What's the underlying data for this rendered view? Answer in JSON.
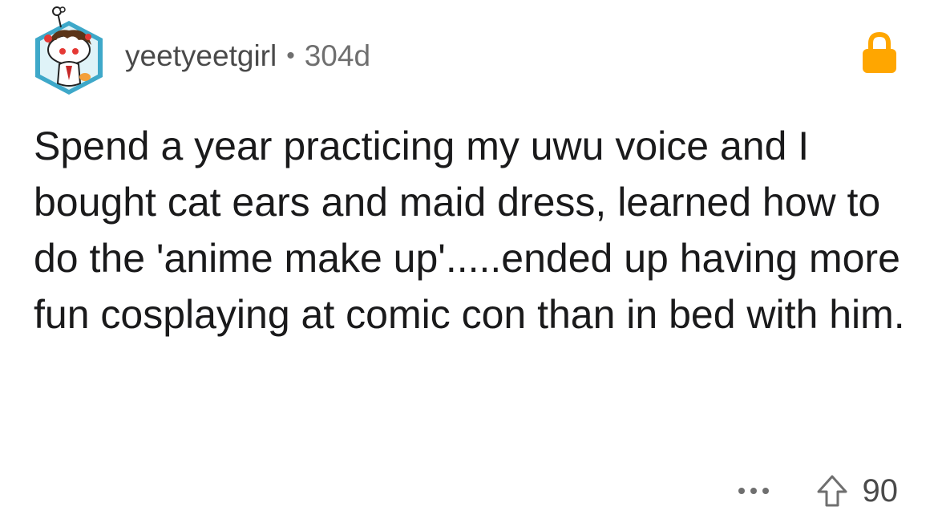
{
  "comment": {
    "username": "yeetyeetgirl",
    "separator": "•",
    "age": "304d",
    "body": "Spend a year practicing my uwu voice and I bought cat ears and maid dress, learned how to do the 'anime make up'.....ended up having more fun cosplaying at comic con than in bed with him.",
    "score": "90"
  },
  "icons": {
    "avatar": "snoo-avatar",
    "lock": "lock-icon",
    "more": "more-options-icon",
    "upvote": "upvote-arrow-icon"
  },
  "colors": {
    "lock": "#ffa600",
    "avatar_border": "#3ea8c9",
    "text": "#1a1a1b",
    "muted": "#6f6f6f"
  }
}
